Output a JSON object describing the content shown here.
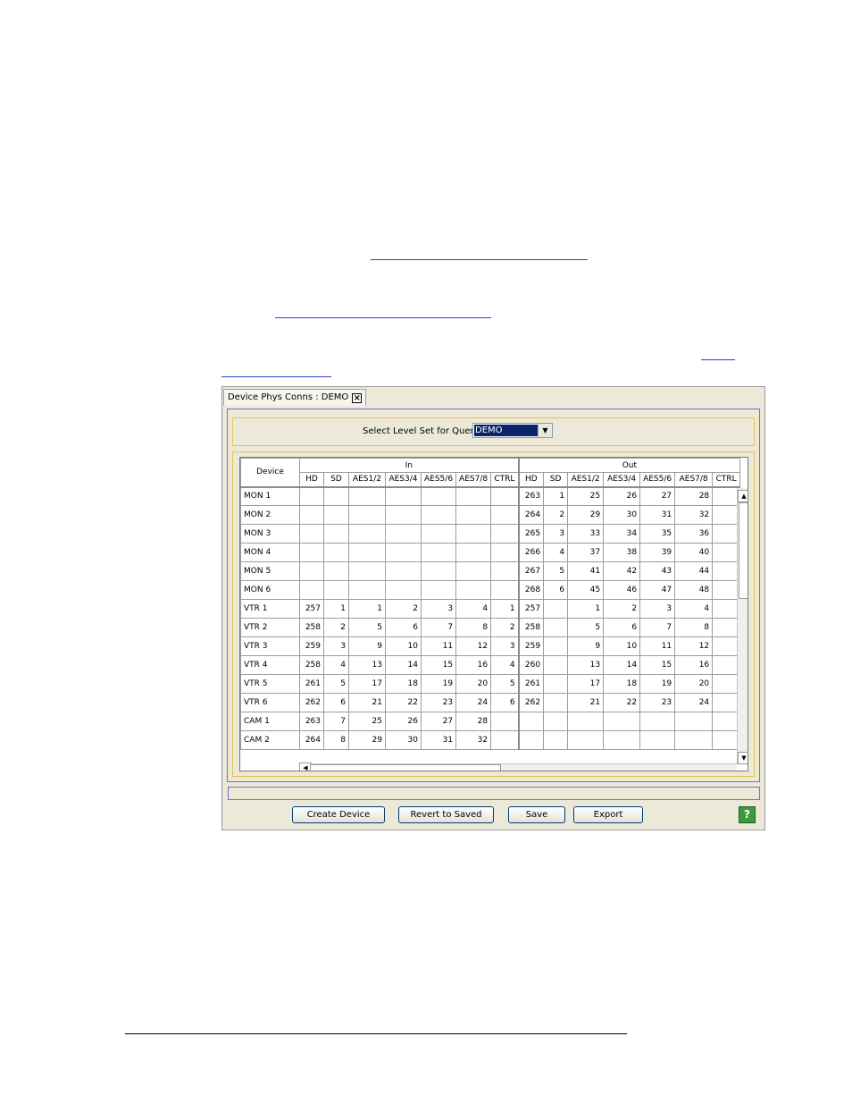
{
  "window": {
    "tab_title": "Device Phys Conns : DEMO",
    "query": {
      "label": "Select Level Set for Query:",
      "selected": "DEMO"
    },
    "grid": {
      "device_header": "Device",
      "in_header": "In",
      "out_header": "Out",
      "in_columns": [
        "HD",
        "SD",
        "AES1/2",
        "AES3/4",
        "AES5/6",
        "AES7/8",
        "CTRL"
      ],
      "out_columns": [
        "HD",
        "SD",
        "AES1/2",
        "AES3/4",
        "AES5/6",
        "AES7/8",
        "CTRL"
      ],
      "rows": [
        {
          "device": "MON 1",
          "in": [
            "",
            "",
            "",
            "",
            "",
            "",
            ""
          ],
          "out": [
            "263",
            "1",
            "25",
            "26",
            "27",
            "28",
            ""
          ]
        },
        {
          "device": "MON 2",
          "in": [
            "",
            "",
            "",
            "",
            "",
            "",
            ""
          ],
          "out": [
            "264",
            "2",
            "29",
            "30",
            "31",
            "32",
            ""
          ]
        },
        {
          "device": "MON 3",
          "in": [
            "",
            "",
            "",
            "",
            "",
            "",
            ""
          ],
          "out": [
            "265",
            "3",
            "33",
            "34",
            "35",
            "36",
            ""
          ]
        },
        {
          "device": "MON 4",
          "in": [
            "",
            "",
            "",
            "",
            "",
            "",
            ""
          ],
          "out": [
            "266",
            "4",
            "37",
            "38",
            "39",
            "40",
            ""
          ]
        },
        {
          "device": "MON 5",
          "in": [
            "",
            "",
            "",
            "",
            "",
            "",
            ""
          ],
          "out": [
            "267",
            "5",
            "41",
            "42",
            "43",
            "44",
            ""
          ]
        },
        {
          "device": "MON 6",
          "in": [
            "",
            "",
            "",
            "",
            "",
            "",
            ""
          ],
          "out": [
            "268",
            "6",
            "45",
            "46",
            "47",
            "48",
            ""
          ]
        },
        {
          "device": "VTR 1",
          "in": [
            "257",
            "1",
            "1",
            "2",
            "3",
            "4",
            "1"
          ],
          "out": [
            "257",
            "",
            "1",
            "2",
            "3",
            "4",
            ""
          ]
        },
        {
          "device": "VTR 2",
          "in": [
            "258",
            "2",
            "5",
            "6",
            "7",
            "8",
            "2"
          ],
          "out": [
            "258",
            "",
            "5",
            "6",
            "7",
            "8",
            ""
          ]
        },
        {
          "device": "VTR 3",
          "in": [
            "259",
            "3",
            "9",
            "10",
            "11",
            "12",
            "3"
          ],
          "out": [
            "259",
            "",
            "9",
            "10",
            "11",
            "12",
            ""
          ]
        },
        {
          "device": "VTR 4",
          "in": [
            "258",
            "4",
            "13",
            "14",
            "15",
            "16",
            "4"
          ],
          "out": [
            "260",
            "",
            "13",
            "14",
            "15",
            "16",
            ""
          ]
        },
        {
          "device": "VTR 5",
          "in": [
            "261",
            "5",
            "17",
            "18",
            "19",
            "20",
            "5"
          ],
          "out": [
            "261",
            "",
            "17",
            "18",
            "19",
            "20",
            ""
          ]
        },
        {
          "device": "VTR 6",
          "in": [
            "262",
            "6",
            "21",
            "22",
            "23",
            "24",
            "6"
          ],
          "out": [
            "262",
            "",
            "21",
            "22",
            "23",
            "24",
            ""
          ]
        },
        {
          "device": "CAM 1",
          "in": [
            "263",
            "7",
            "25",
            "26",
            "27",
            "28",
            ""
          ],
          "out": [
            "",
            "",
            "",
            "",
            "",
            "",
            ""
          ]
        },
        {
          "device": "CAM 2",
          "in": [
            "264",
            "8",
            "29",
            "30",
            "31",
            "32",
            ""
          ],
          "out": [
            "",
            "",
            "",
            "",
            "",
            "",
            ""
          ]
        }
      ]
    },
    "buttons": {
      "create_device": "Create Device",
      "revert": "Revert to Saved",
      "save": "Save",
      "export": "Export",
      "help": "?"
    }
  }
}
